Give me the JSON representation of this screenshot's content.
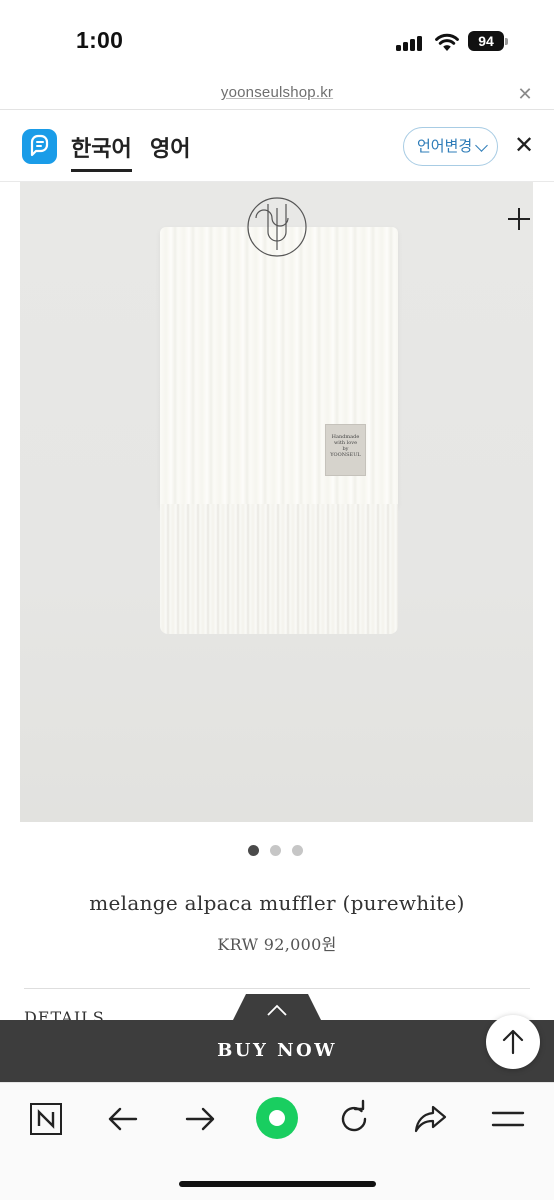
{
  "status": {
    "time": "1:00",
    "battery": "94"
  },
  "url_bar": {
    "url": "yoonseulshop.kr",
    "close_label": "✕"
  },
  "translator": {
    "tabs": [
      {
        "label": "한국어",
        "active": true
      },
      {
        "label": "영어",
        "active": false
      }
    ],
    "change_language_label": "언어변경",
    "close_label": "✕"
  },
  "product": {
    "label_tag_lines": [
      "Handmade",
      "with love",
      "by",
      "YOONSEUL"
    ],
    "carousel": {
      "count": 3,
      "active_index": 0
    },
    "name": "melange alpaca muffler (purewhite)",
    "price": "KRW 92,000원",
    "details_label": "DETAILS"
  },
  "buy_bar": {
    "label": "BUY NOW"
  },
  "browser_toolbar": {
    "buttons": [
      "naver-icon",
      "back-arrow-icon",
      "forward-arrow-icon",
      "home-icon",
      "refresh-icon",
      "share-icon",
      "menu-icon"
    ],
    "home_color": "#19ce60"
  },
  "colors": {
    "papago_blue": "#1a9ce8",
    "change_button_blue": "#2e7cb8",
    "buy_bar": "#3d3d3d"
  }
}
